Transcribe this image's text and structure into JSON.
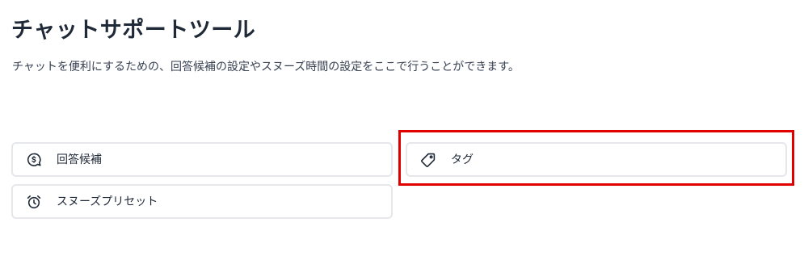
{
  "header": {
    "title": "チャットサポートツール",
    "description": "チャットを便利にするための、回答候補の設定やスヌーズ時間の設定をここで行うことができます。"
  },
  "tools": {
    "answer_candidates": {
      "label": "回答候補",
      "icon": "chat-dollar-icon"
    },
    "tag": {
      "label": "タグ",
      "icon": "tag-icon"
    },
    "snooze_preset": {
      "label": "スヌーズプリセット",
      "icon": "alarm-clock-icon"
    }
  },
  "colors": {
    "highlight": "#e00000",
    "card_border": "#e5e7eb",
    "text": "#1f2937"
  }
}
